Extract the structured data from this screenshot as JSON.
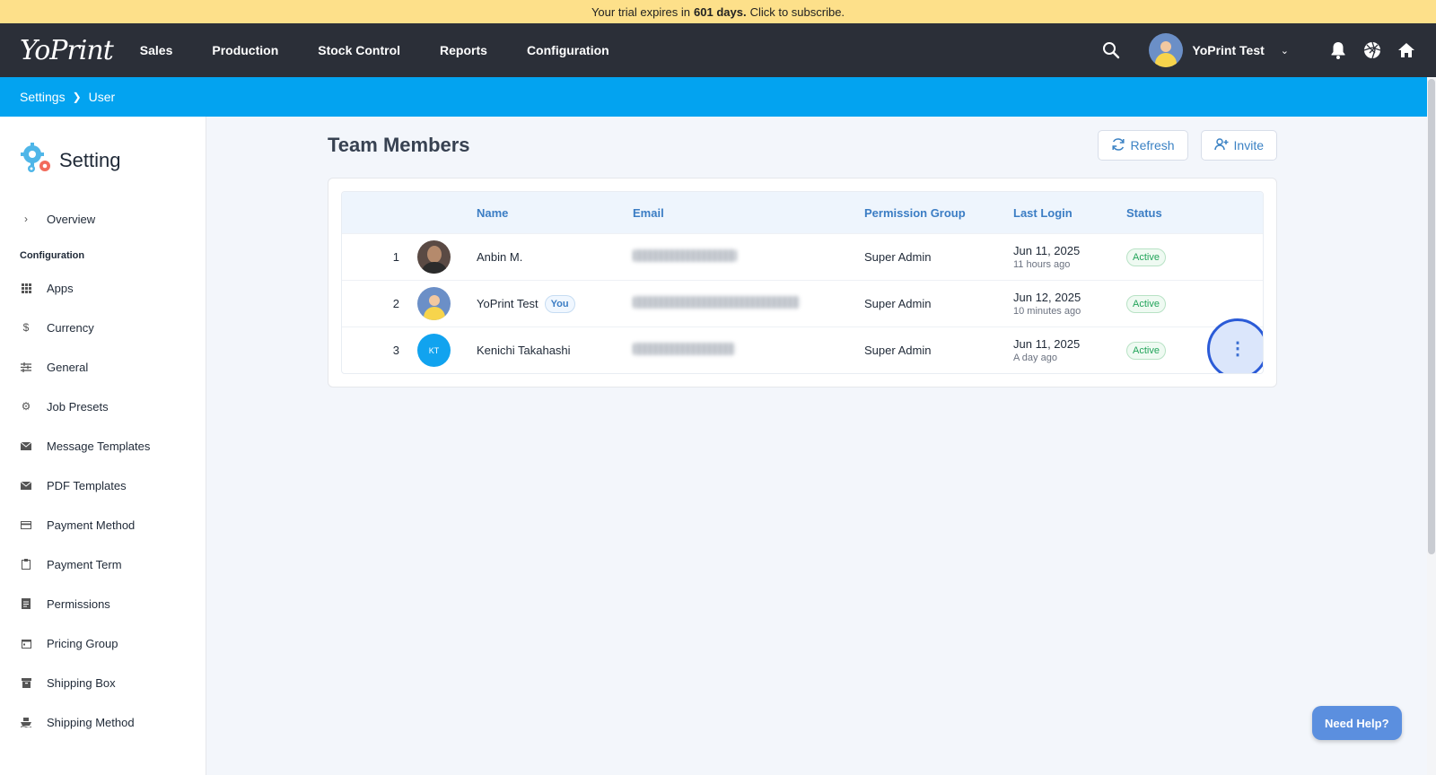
{
  "trial": {
    "prefix": "Your trial expires in",
    "days": "601 days.",
    "suffix": "Click to subscribe."
  },
  "nav": {
    "logo": "YoPrint",
    "links": [
      "Sales",
      "Production",
      "Stock Control",
      "Reports",
      "Configuration"
    ],
    "user_name": "YoPrint Test"
  },
  "breadcrumb": {
    "parent": "Settings",
    "current": "User"
  },
  "sidebar": {
    "title": "Setting",
    "overview": "Overview",
    "section_label": "Configuration",
    "items": [
      {
        "label": "Apps",
        "icon": "grid-icon"
      },
      {
        "label": "Currency",
        "icon": "dollar-icon"
      },
      {
        "label": "General",
        "icon": "sliders-icon"
      },
      {
        "label": "Job Presets",
        "icon": "gear-icon"
      },
      {
        "label": "Message Templates",
        "icon": "mail-icon"
      },
      {
        "label": "PDF Templates",
        "icon": "mail-icon"
      },
      {
        "label": "Payment Method",
        "icon": "card-icon"
      },
      {
        "label": "Payment Term",
        "icon": "clipboard-icon"
      },
      {
        "label": "Permissions",
        "icon": "document-icon"
      },
      {
        "label": "Pricing Group",
        "icon": "calendar-icon"
      },
      {
        "label": "Shipping Box",
        "icon": "box-icon"
      },
      {
        "label": "Shipping Method",
        "icon": "ship-icon"
      }
    ]
  },
  "main": {
    "title": "Team Members",
    "refresh_label": "Refresh",
    "invite_label": "Invite",
    "columns": {
      "name": "Name",
      "email": "Email",
      "permission": "Permission Group",
      "last_login": "Last Login",
      "status": "Status"
    },
    "rows": [
      {
        "num": "1",
        "name": "Anbin M.",
        "you": "",
        "permission": "Super Admin",
        "login_date": "Jun 11, 2025",
        "login_rel": "11 hours ago",
        "status": "Active",
        "avatar": "photo"
      },
      {
        "num": "2",
        "name": "YoPrint Test",
        "you": "You",
        "permission": "Super Admin",
        "login_date": "Jun 12, 2025",
        "login_rel": "10 minutes ago",
        "status": "Active",
        "avatar": "default"
      },
      {
        "num": "3",
        "name": "Kenichi Takahashi",
        "you": "",
        "initials": "KT",
        "permission": "Super Admin",
        "login_date": "Jun 11, 2025",
        "login_rel": "A day ago",
        "status": "Active",
        "avatar": "initials"
      }
    ]
  },
  "help_label": "Need Help?",
  "colors": {
    "brand_blue": "#03a3f0",
    "nav_dark": "#2b2f38",
    "banner": "#fde08a",
    "active_green": "#22a45a"
  }
}
